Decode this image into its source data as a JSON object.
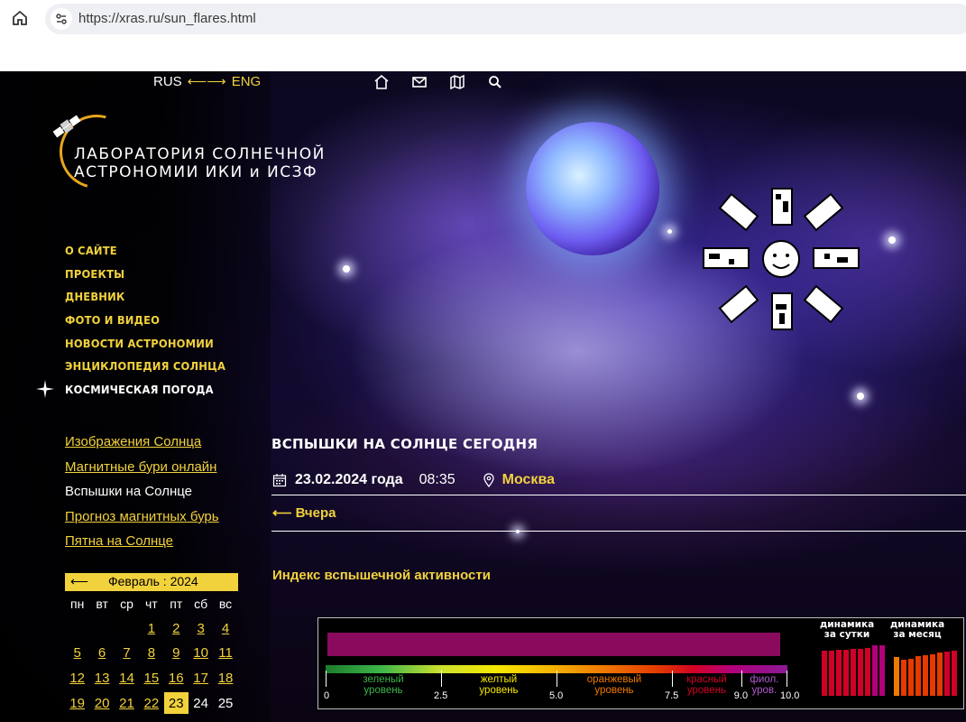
{
  "browser": {
    "url": "https://xras.ru/sun_flares.html"
  },
  "lang": {
    "rus": "RUS",
    "arrow": "⟵⟶",
    "eng": "ENG"
  },
  "top_icons": [
    "home-icon",
    "mail-icon",
    "map-icon",
    "search-icon"
  ],
  "logo": {
    "line1": "ЛАБОРАТОРИЯ СОЛНЕЧНОЙ",
    "line2": "АСТРОНОМИИ  ИКИ и ИСЗФ"
  },
  "menu": [
    {
      "label": "О САЙТЕ"
    },
    {
      "label": "ПРОЕКТЫ"
    },
    {
      "label": "ДНЕВНИК"
    },
    {
      "label": "ФОТО И ВИДЕО"
    },
    {
      "label": "НОВОСТИ АСТРОНОМИИ"
    },
    {
      "label": "ЭНЦИКЛОПЕДИЯ СОЛНЦА"
    },
    {
      "label": "КОСМИЧЕСКАЯ ПОГОДА"
    }
  ],
  "submenu": [
    {
      "label": "Изображения Солнца"
    },
    {
      "label": "Магнитные бури онлайн"
    },
    {
      "label": "Вспышки на Солнце"
    },
    {
      "label": "Прогноз магнитных бурь"
    },
    {
      "label": "Пятна на Солнце"
    }
  ],
  "calendar": {
    "prev": "⟵",
    "month": "Февраль : 2024",
    "weekdays": [
      "пн",
      "вт",
      "ср",
      "чт",
      "пт",
      "сб",
      "вс"
    ],
    "weeks": [
      [
        "",
        "",
        "",
        "1",
        "2",
        "3",
        "4"
      ],
      [
        "5",
        "6",
        "7",
        "8",
        "9",
        "10",
        "11"
      ],
      [
        "12",
        "13",
        "14",
        "15",
        "16",
        "17",
        "18"
      ],
      [
        "19",
        "20",
        "21",
        "22",
        "23",
        "24",
        "25"
      ]
    ],
    "today": "23",
    "last_linked_day": 23
  },
  "main": {
    "title": "ВСПЫШКИ НА СОЛНЦЕ СЕГОДНЯ",
    "date": "23.02.2024 года",
    "time": "08:35",
    "city": "Москва",
    "yesterday": "⟵ Вчера",
    "index_title": "Индекс вспышечной активности"
  },
  "flare": {
    "current_index": 10.0,
    "bar_color": "#8a0a5e",
    "scale_max": 10.0,
    "segments": [
      {
        "from": 0,
        "to": 2.5,
        "line1": "зеленый",
        "line2": "уровень",
        "color": "#3db64a"
      },
      {
        "from": 2.5,
        "to": 5.0,
        "line1": "желтый",
        "line2": "уровень",
        "color": "#f5e800"
      },
      {
        "from": 5.0,
        "to": 7.5,
        "line1": "оранжевый",
        "line2": "уровень",
        "color": "#f07a00"
      },
      {
        "from": 7.5,
        "to": 9.0,
        "line1": "красный",
        "line2": "уровень",
        "color": "#d10026"
      },
      {
        "from": 9.0,
        "to": 10.0,
        "line1": "фиол.",
        "line2": "уров.",
        "color": "#b05ad0"
      }
    ],
    "ticks": [
      "0",
      "2.5",
      "5.0",
      "7.5",
      "9.0",
      "10.0"
    ],
    "tick_values": [
      0,
      2.5,
      5.0,
      7.5,
      9.0,
      10.0
    ],
    "day_title": "динамика\nза сутки",
    "month_title": "динамика\nза месяц",
    "day_dynamics": [
      9.0,
      9.0,
      9.1,
      9.1,
      9.2,
      9.3,
      9.4,
      10.0,
      10.0
    ],
    "day_colors": [
      "#d10026",
      "#d10026",
      "#d10026",
      "#d10026",
      "#d10026",
      "#d10026",
      "#d10026",
      "#b2007a",
      "#b2007a"
    ],
    "month_dynamics": [
      7.6,
      7.2,
      7.4,
      7.8,
      8.0,
      8.3,
      8.5,
      8.8,
      9.0
    ],
    "month_colors": [
      "#f07a00",
      "#e53a00",
      "#e53a00",
      "#e53a00",
      "#e53a00",
      "#e53a00",
      "#e53a00",
      "#d10026",
      "#d10026"
    ]
  }
}
